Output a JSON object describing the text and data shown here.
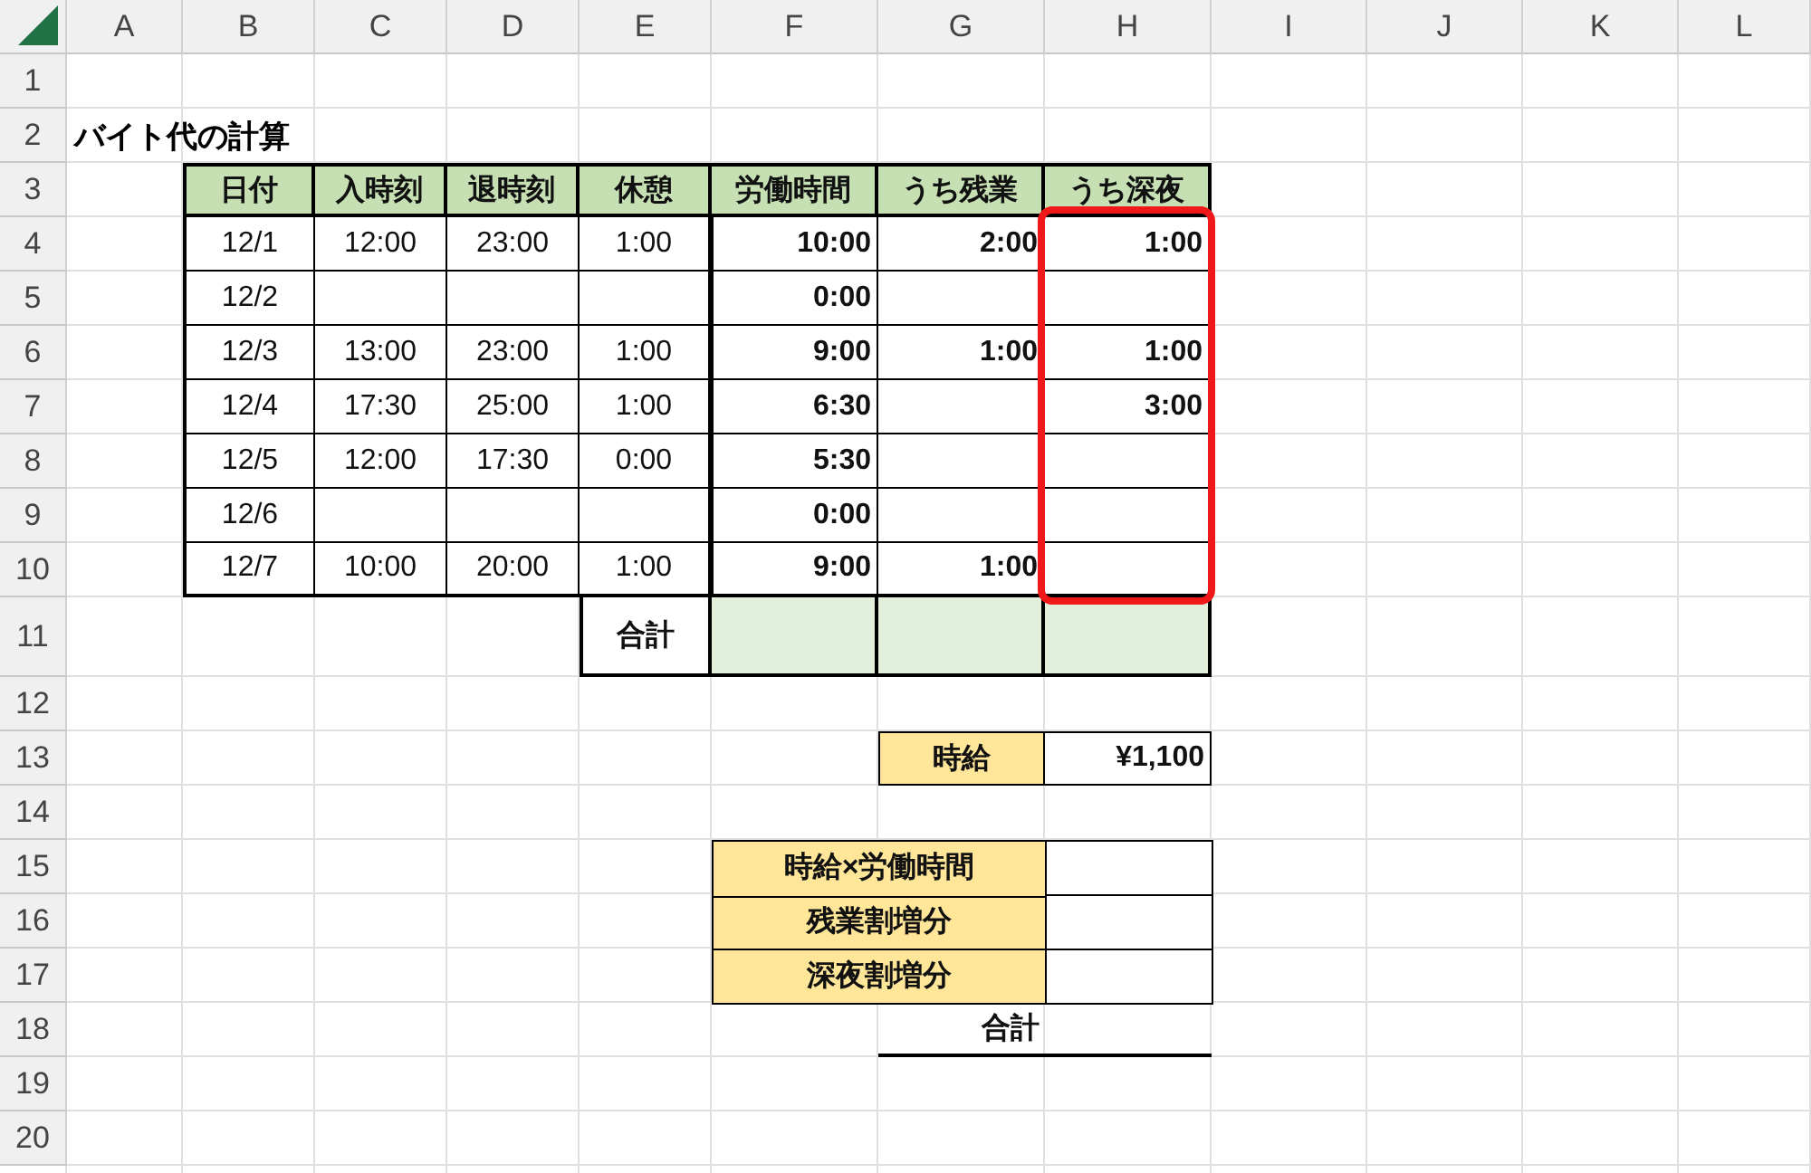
{
  "column_headers": [
    "A",
    "B",
    "C",
    "D",
    "E",
    "F",
    "G",
    "H",
    "I",
    "J",
    "K",
    "L"
  ],
  "row_headers": [
    "1",
    "2",
    "3",
    "4",
    "5",
    "6",
    "7",
    "8",
    "9",
    "10",
    "11",
    "12",
    "13",
    "14",
    "15",
    "16",
    "17",
    "18",
    "19",
    "20"
  ],
  "title": "バイト代の計算",
  "table": {
    "columns": [
      "日付",
      "入時刻",
      "退時刻",
      "休憩",
      "労働時間",
      "うち残業",
      "うち深夜"
    ],
    "rows": [
      [
        "12/1",
        "12:00",
        "23:00",
        "1:00",
        "10:00",
        "2:00",
        "1:00"
      ],
      [
        "12/2",
        null,
        null,
        null,
        "0:00",
        null,
        null
      ],
      [
        "12/3",
        "13:00",
        "23:00",
        "1:00",
        "9:00",
        "1:00",
        "1:00"
      ],
      [
        "12/4",
        "17:30",
        "25:00",
        "1:00",
        "6:30",
        null,
        "3:00"
      ],
      [
        "12/5",
        "12:00",
        "17:30",
        "0:00",
        "5:30",
        null,
        null
      ],
      [
        "12/6",
        null,
        null,
        null,
        "0:00",
        null,
        null
      ],
      [
        "12/7",
        "10:00",
        "20:00",
        "1:00",
        "9:00",
        "1:00",
        null
      ]
    ],
    "total_label": "合計"
  },
  "hourly_rate": {
    "label": "時給",
    "value": "¥1,100"
  },
  "summary": {
    "items": [
      "時給×労働時間",
      "残業割増分",
      "深夜割増分"
    ],
    "total_label": "合計"
  }
}
